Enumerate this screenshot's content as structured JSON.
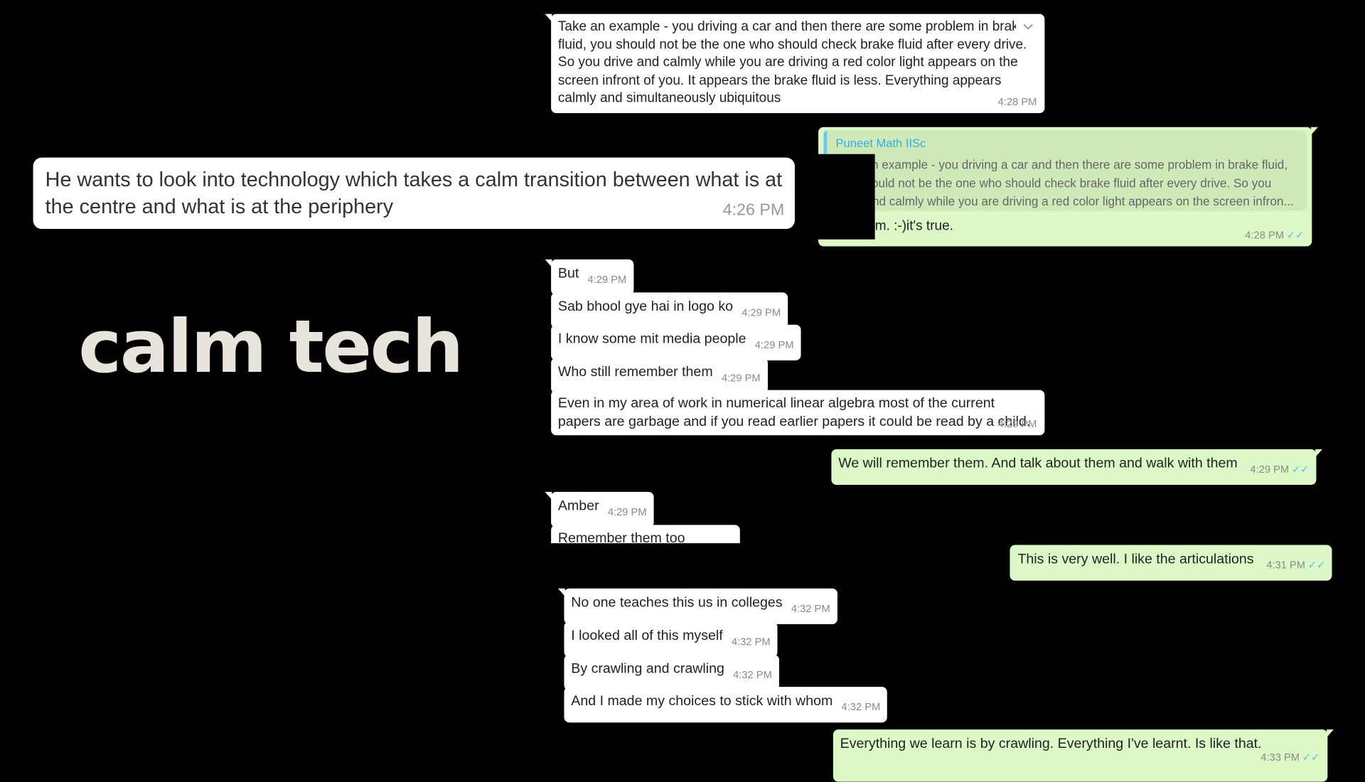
{
  "title": "calm tech",
  "big_quote": {
    "text": "He wants to look into technology which takes a calm transition between what is at the centre and what is at the periphery",
    "time": "4:26 PM"
  },
  "msg_top": {
    "text": "Take an example - you driving a car and then there are some problem in brake fluid, you should not be the one who should check brake fluid after every drive. So you drive and calmly while you are driving a red color light appears on the screen infront of you. It appears the brake fluid is less. Everything appears calmly and simultaneously ubiquitous",
    "time": "4:28 PM"
  },
  "reply": {
    "author": "Puneet Math IISc",
    "quoted": "Take an example - you driving a car and then there are some problem in brake fluid, you should not be the one who should check brake fluid after every drive. So you drive and calmly while you are driving a red color light appears on the screen infron...",
    "text": "Very calm. :-)it's true.",
    "time": "4:28 PM"
  },
  "messages_a": [
    {
      "text": "But",
      "time": "4:29 PM"
    },
    {
      "text": "Sab bhool gye hai in logo ko",
      "time": "4:29 PM"
    },
    {
      "text": "I know some mit media people",
      "time": "4:29 PM"
    },
    {
      "text": "Who still remember them",
      "time": "4:29 PM"
    }
  ],
  "msg_linear": {
    "text": "Even in my area of work in numerical linear algebra most of the current papers are garbage and if you read earlier papers it could be read by a child.",
    "time": "4:29 PM"
  },
  "msg_remember": {
    "text": "We will remember them. And talk about them and walk with them",
    "time": "4:29 PM"
  },
  "msg_amber": {
    "text": "Amber",
    "time": "4:29 PM"
  },
  "msg_cut": {
    "text": "Remember them too"
  },
  "msg_articulations": {
    "text": "This is very well. I like the articulations",
    "time": "4:31 PM"
  },
  "messages_b": [
    {
      "text": "No one teaches this us in colleges",
      "time": "4:32 PM"
    },
    {
      "text": "I looked all of this myself",
      "time": "4:32 PM"
    },
    {
      "text": "By crawling and crawling",
      "time": "4:32 PM"
    },
    {
      "text": "And I made my choices to stick with whom",
      "time": "4:32 PM"
    }
  ],
  "msg_last": {
    "text": "Everything we learn is  by crawling. Everything I've learnt. Is like that.",
    "time": "4:33 PM"
  },
  "icons": {
    "tick": "double-check-icon",
    "menu": "chevron-down-icon"
  }
}
